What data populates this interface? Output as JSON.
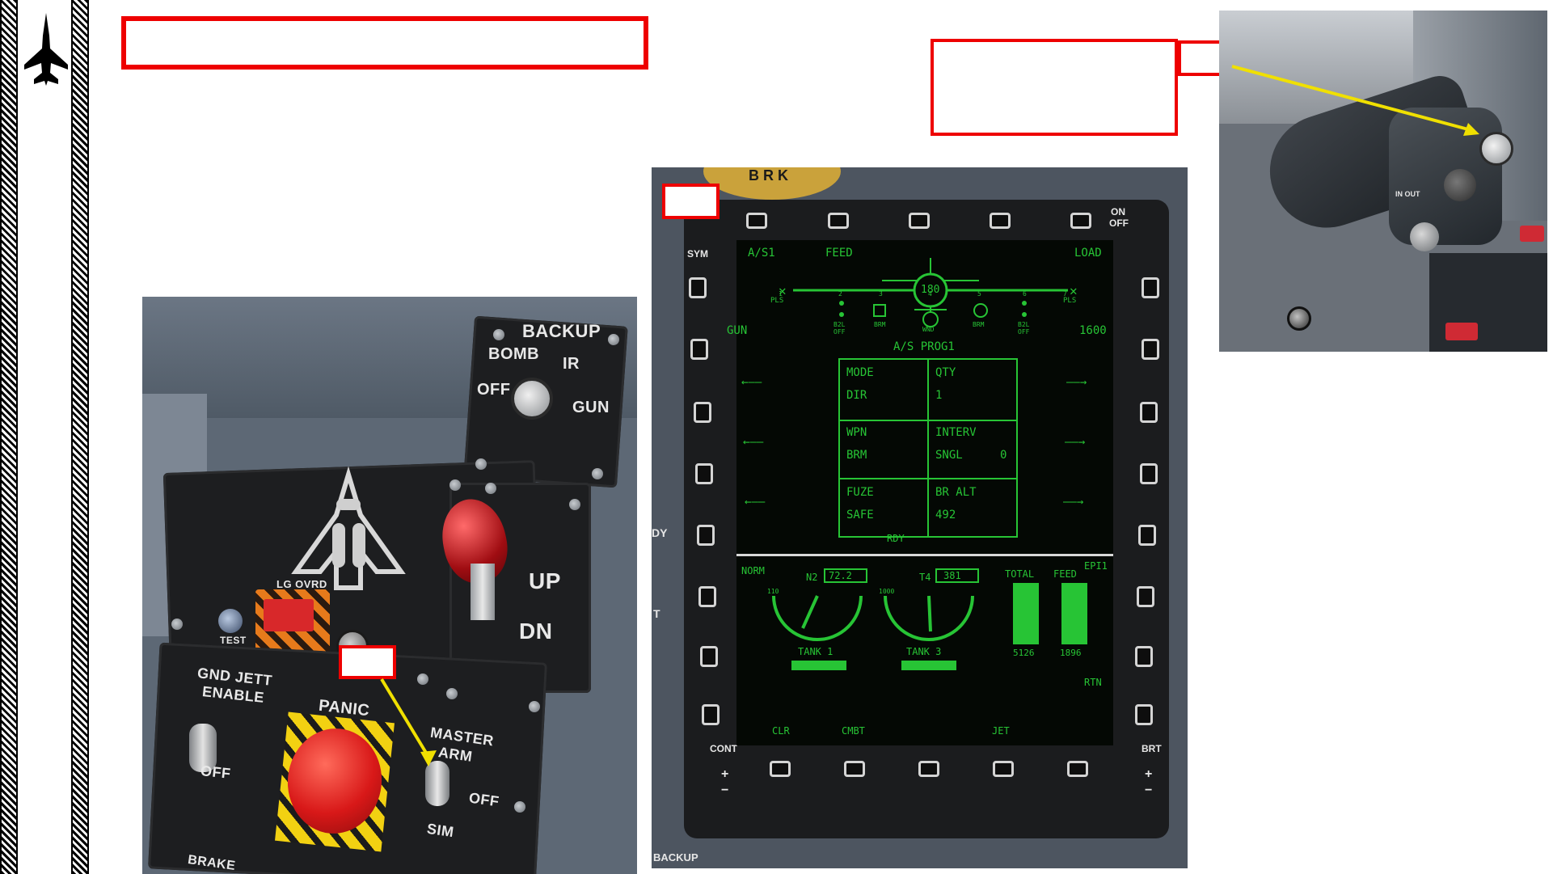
{
  "left_panel": {
    "backup": "BACKUP",
    "bomb": "BOMB",
    "ir": "IR",
    "off": "OFF",
    "gun": "GUN",
    "lg_ovrd": "LG OVRD",
    "test": "TEST",
    "up": "UP",
    "dn": "DN",
    "gnd_jett": "GND JETT",
    "enable": "ENABLE",
    "off2": "OFF",
    "panic": "PANIC",
    "master": "MASTER",
    "arm": "ARM",
    "off3": "OFF",
    "sim": "SIM",
    "brake": "BRAKE",
    "br": "BR"
  },
  "mfd": {
    "on": "ON",
    "off": "OFF",
    "brk": "B R K",
    "sym": "SYM",
    "cont": "CONT",
    "brt": "BRT",
    "plus": "+",
    "minus": "−",
    "dy": "DY",
    "t": "T",
    "backup_bottom": "BACKUP",
    "screen": {
      "as1": "A/S1",
      "feed": "FEED",
      "load": "LOAD",
      "gun": "GUN",
      "rounds": "1600",
      "fuel_center": "180",
      "stations": [
        {
          "num": "1",
          "label": "PLS"
        },
        {
          "num": "2",
          "label": "B2L\nOFF"
        },
        {
          "num": "3",
          "label": "BRM"
        },
        {
          "num": "4",
          "label": "WND"
        },
        {
          "num": "5",
          "label": "BRM"
        },
        {
          "num": "6",
          "label": "B2L\nOFF"
        },
        {
          "num": "7",
          "label": "PLS"
        }
      ],
      "prog": "A/S PROG1",
      "grid": [
        {
          "k": "MODE",
          "v": "DIR"
        },
        {
          "k": "QTY",
          "v": "1"
        },
        {
          "k": "WPN",
          "v": "BRM"
        },
        {
          "k": "INTERV",
          "v": "SNGL",
          "v2": "0"
        },
        {
          "k": "FUZE",
          "v": "SAFE"
        },
        {
          "k": "BR ALT",
          "v": "492"
        }
      ],
      "rdy": "RDY",
      "arrow_left": "←——",
      "arrow_right": "——→",
      "norm": "NORM",
      "n2": "N2",
      "n2_val": "72.2",
      "t4": "T4",
      "t4_val": "381",
      "total": "TOTAL",
      "feed2": "FEED",
      "epi": "EPI1",
      "total_val": "5126",
      "feed_val": "1896",
      "tank1": "TANK 1",
      "tank3": "TANK 3",
      "rtn": "RTN",
      "clr": "CLR",
      "cmbt": "CMBT",
      "jet": "JET",
      "n2_scale_lo": "110",
      "t4_scale_lo": "1000"
    }
  },
  "right_photo": {
    "in_out": "IN OUT"
  },
  "colors": {
    "annotation_red": "#ee0000",
    "arrow_yellow": "#f0e000",
    "mfd_green": "#27c435"
  }
}
